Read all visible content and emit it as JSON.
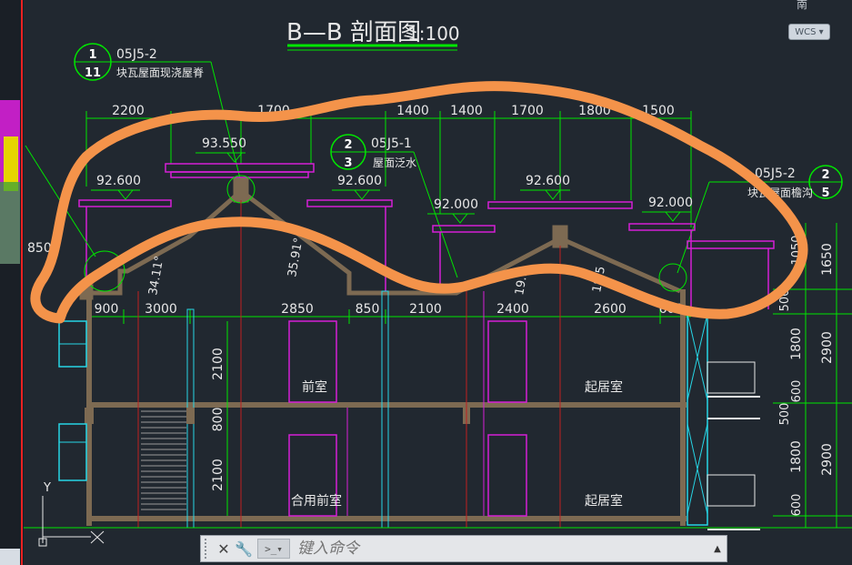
{
  "drawing": {
    "title": "B—B 剖面图",
    "scale": "1:100",
    "corner_label": "南"
  },
  "viewcube": {
    "wcs_label": "WCS"
  },
  "callouts": {
    "left": {
      "ref": "05J5-2",
      "num": "1",
      "sheet": "11",
      "desc": "块瓦屋面现浇屋脊"
    },
    "mid": {
      "ref": "05J5-1",
      "num": "2",
      "sheet": "3",
      "desc": "屋面泛水"
    },
    "right": {
      "ref": "05J5-2",
      "num": "2",
      "sheet": "5",
      "desc": "块瓦屋面檐沟"
    }
  },
  "elevations": [
    "93.550",
    "92.600",
    "92.600",
    "92.000",
    "92.600",
    "92.000"
  ],
  "top_dims": [
    "2200",
    "1700",
    "1400",
    "1400",
    "1700",
    "1800",
    "1500"
  ],
  "bottom_dims": [
    "900",
    "3000",
    "2850",
    "850",
    "2100",
    "2400",
    "2600",
    "600"
  ],
  "left_dim": "850",
  "slope_labels": [
    "34.11°",
    "35.91°",
    "19.9",
    "18.5"
  ],
  "vertical_dims": [
    "2100",
    "800",
    "2100"
  ],
  "right_dims_inner": [
    "1050",
    "500",
    "1800",
    "600",
    "500",
    "1800",
    "600"
  ],
  "right_dims_outer": [
    "1650",
    "2900",
    "2900"
  ],
  "rooms": [
    "前室",
    "起居室",
    "合用前室",
    "起居室"
  ],
  "axis": {
    "y": "Y",
    "x": "X"
  },
  "command_line": {
    "placeholder": "键入命令",
    "close": "✕",
    "settings": "🔧",
    "prompt_icon": ">_▾",
    "expand": "▲"
  },
  "colors": {
    "bg": "#212830",
    "green": "#00e600",
    "magenta": "#d61fd6",
    "cyan": "#27d6e6",
    "wall": "#7d6a52",
    "orange": "#f4934a",
    "white": "#e8e8e8"
  }
}
